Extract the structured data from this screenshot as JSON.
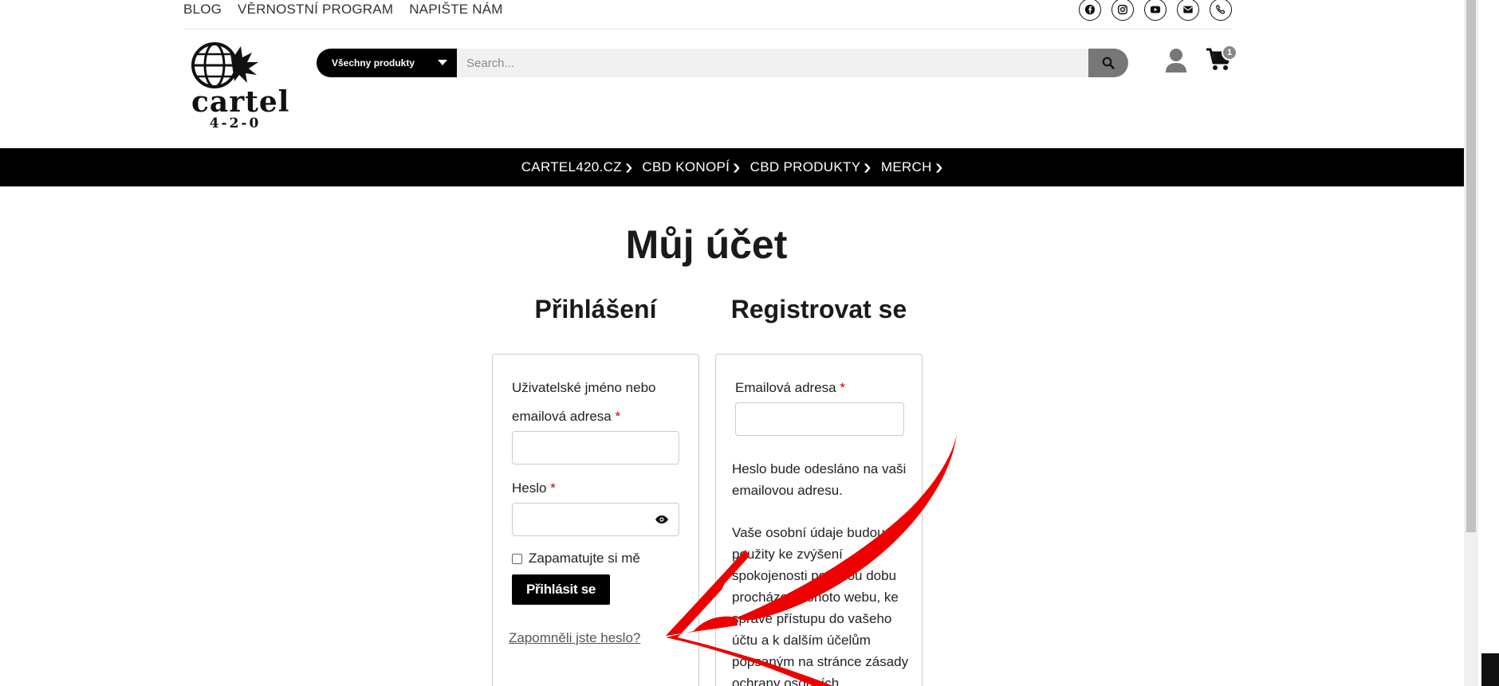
{
  "topbar": {
    "links": [
      "BLOG",
      "VĚRNOSTNÍ PROGRAM",
      "NAPIŠTE NÁM"
    ],
    "socials": [
      "facebook-icon",
      "instagram-icon",
      "youtube-icon",
      "email-icon",
      "phone-icon"
    ]
  },
  "logo": {
    "text": "cartel",
    "number": "4-2-0"
  },
  "search": {
    "category": "Všechny produkty",
    "placeholder": "Search..."
  },
  "cart": {
    "count": "1"
  },
  "nav": {
    "items": [
      "CARTEL420.CZ",
      "CBD KONOPÍ",
      "CBD PRODUKTY",
      "MERCH"
    ]
  },
  "page": {
    "title": "Můj účet"
  },
  "login": {
    "title": "Přihlášení",
    "username_label_1": "Uživatelské jméno nebo",
    "username_label_2": "emailová adresa",
    "password_label": "Heslo",
    "required_mark": "*",
    "remember_label": "Zapamatujte si mě",
    "submit_label": "Přihlásit se",
    "forgot_label": "Zapomněli jste heslo?"
  },
  "register": {
    "title": "Registrovat se",
    "email_label": "Emailová adresa",
    "required_mark": "*",
    "info": "Heslo bude odesláno na vaši emailovou adresu.",
    "privacy": "Vaše osobní údaje budou použity ke zvýšení spokojenosti po celou dobu procházení tohoto webu, ke správě přístupu do vašeho účtu a k dalším účelům popsaným na stránce zásady ochrany osobních"
  },
  "colors": {
    "brand": "#000000",
    "required": "#cc0000",
    "arrow": "#ee0000"
  }
}
